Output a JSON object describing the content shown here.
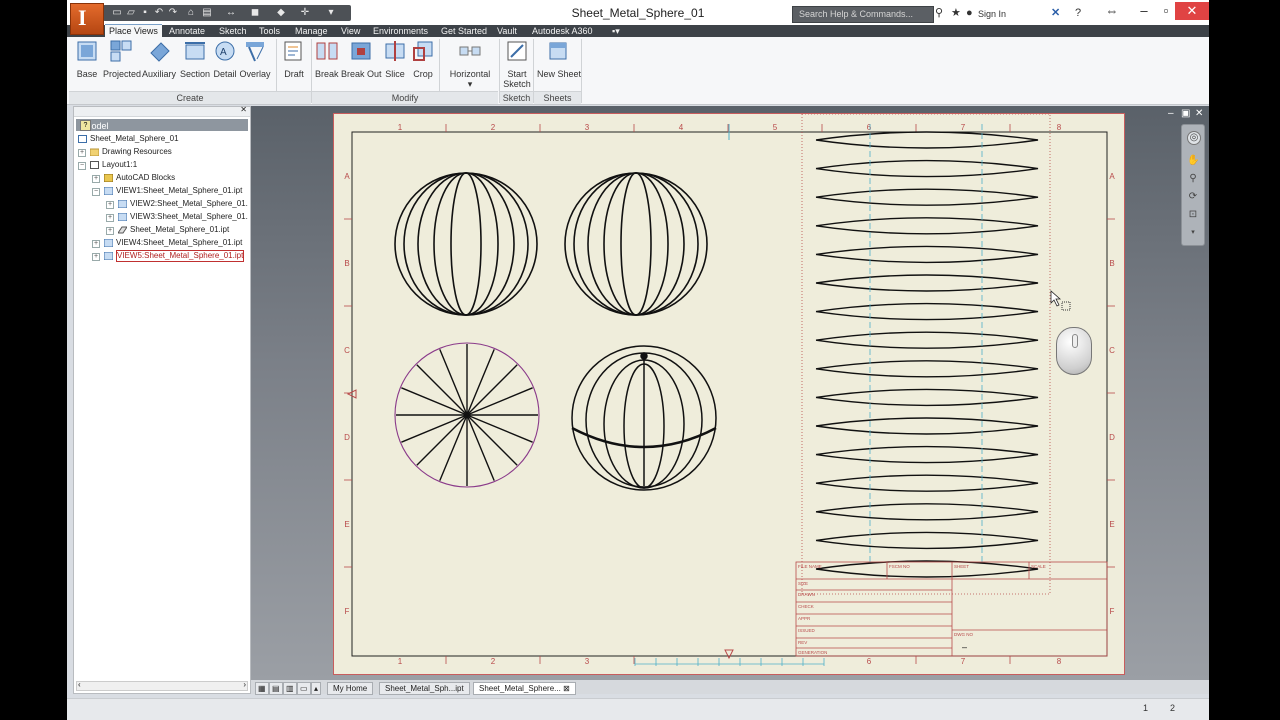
{
  "app": {
    "title": "Sheet_Metal_Sphere_01"
  },
  "quick_access": {
    "icons": [
      "new-icon",
      "open-icon",
      "save-icon",
      "undo-icon",
      "redo-icon",
      "home-icon",
      "print-icon",
      "measure-icon",
      "material-icon",
      "appearance-icon",
      "select-icon"
    ]
  },
  "header": {
    "search_placeholder": "Search Help & Commands...",
    "sign_in": "Sign In"
  },
  "ribbon": {
    "tabs": [
      "Place Views",
      "Annotate",
      "Sketch",
      "Tools",
      "Manage",
      "View",
      "Environments",
      "Get Started",
      "Vault",
      "Autodesk A360"
    ],
    "active_tab": "Place Views",
    "groups": {
      "create": {
        "label": "Create",
        "buttons": [
          "Base",
          "Projected",
          "Auxiliary",
          "Section",
          "Detail",
          "Overlay",
          "Draft"
        ]
      },
      "modify": {
        "label": "Modify",
        "buttons": [
          "Break",
          "Break Out",
          "Slice",
          "Crop",
          "Horizontal"
        ]
      },
      "sketch": {
        "label": "Sketch",
        "buttons": [
          "Start Sketch"
        ]
      },
      "sheets": {
        "label": "Sheets",
        "buttons": [
          "New Sheet"
        ]
      }
    }
  },
  "browser": {
    "header": "Model",
    "items": [
      {
        "label": "Sheet_Metal_Sphere_01",
        "icon": "drawing-icon"
      },
      {
        "label": "Drawing Resources",
        "icon": "folder-icon"
      },
      {
        "label": "Layout1:1",
        "icon": "sheet-icon"
      },
      {
        "label": "AutoCAD Blocks",
        "icon": "blocks-icon"
      },
      {
        "label": "VIEW1:Sheet_Metal_Sphere_01.ipt",
        "icon": "view-icon"
      },
      {
        "label": "VIEW2:Sheet_Metal_Sphere_01.",
        "icon": "view-icon"
      },
      {
        "label": "VIEW3:Sheet_Metal_Sphere_01.",
        "icon": "view-icon"
      },
      {
        "label": "Sheet_Metal_Sphere_01.ipt",
        "icon": "part-icon"
      },
      {
        "label": "VIEW4:Sheet_Metal_Sphere_01.ipt",
        "icon": "view-icon"
      },
      {
        "label": "VIEW5:Sheet_Metal_Sphere_01.ipt",
        "icon": "view-icon"
      }
    ]
  },
  "drawing": {
    "top_zones": [
      "1",
      "2",
      "3",
      "4",
      "5",
      "6",
      "7",
      "8"
    ],
    "bottom_zones": [
      "1",
      "2",
      "3",
      "6",
      "7",
      "8"
    ],
    "row_zones": [
      "A",
      "B",
      "C",
      "D",
      "E",
      "F"
    ],
    "title_block": {
      "header_cells": [
        "FILE NAME",
        "FSCM NO",
        "SHEET",
        "SCALE"
      ],
      "rows": [
        "SIZE",
        "DRAWN",
        "CHECK",
        "APPR",
        "ISSUED",
        "REV",
        "GENERATION"
      ],
      "dwg_label": "DWG NO",
      "dash": "–"
    }
  },
  "doc_tabs": [
    "My Home",
    "Sheet_Metal_Sph...ipt",
    "Sheet_Metal_Sphere..."
  ],
  "status": {
    "left_num": "1",
    "right_num": "2"
  },
  "colors": {
    "accent": "#e46b2c",
    "sheet": "#efeddb",
    "border_red": "#b84a4a",
    "center_cyan": "#4fb0c8"
  }
}
